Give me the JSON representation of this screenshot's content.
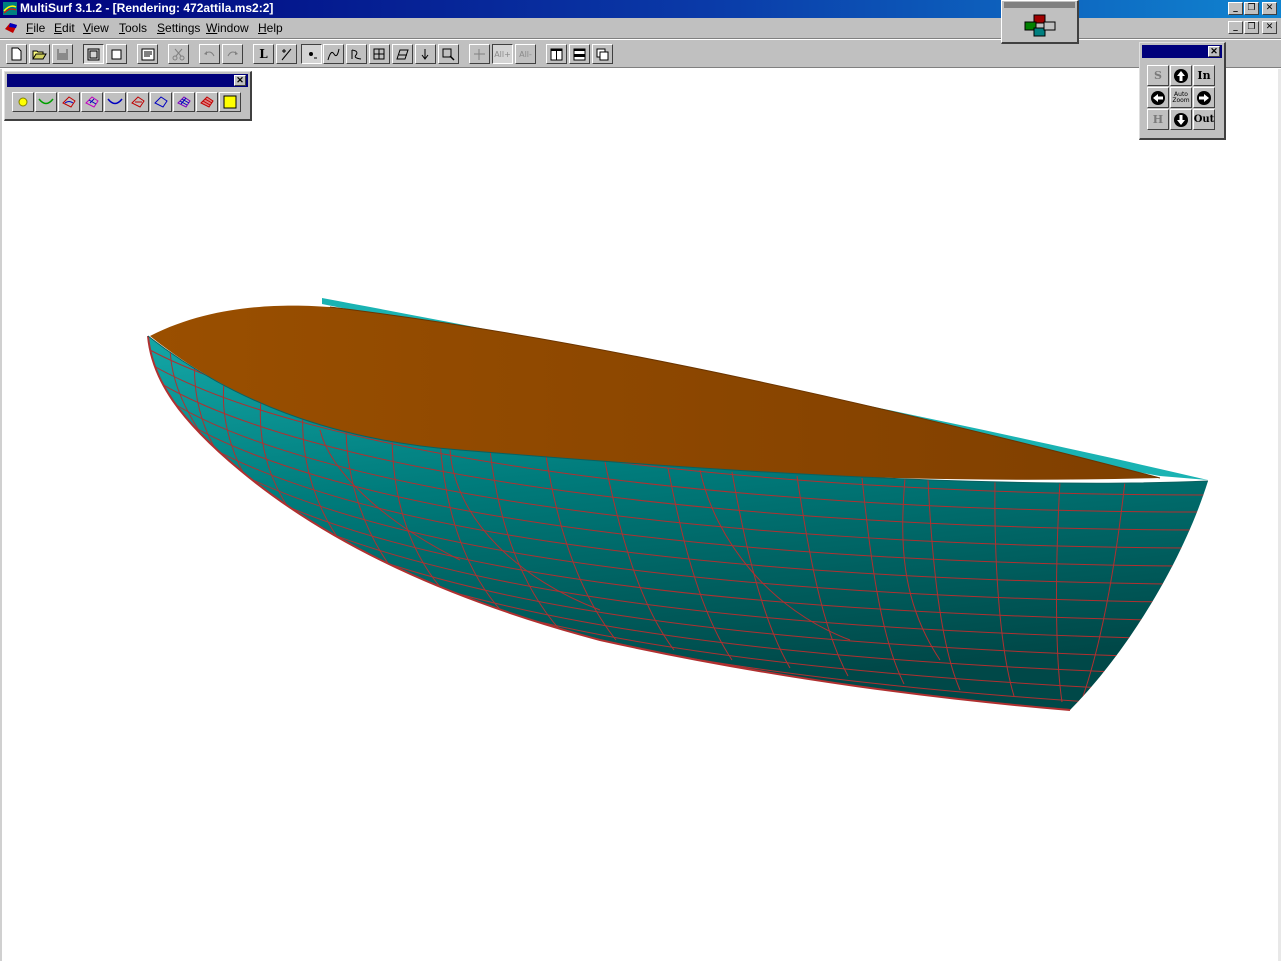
{
  "window": {
    "title": "MultiSurf 3.1.2 - [Rendering: 472attila.ms2:2]",
    "minimize": "_",
    "restore": "❐",
    "close": "✕"
  },
  "menu": {
    "items": [
      "File",
      "Edit",
      "View",
      "Tools",
      "Settings",
      "Window",
      "Help"
    ]
  },
  "toolbar": {
    "buttons": [
      {
        "name": "new-icon"
      },
      {
        "name": "open-icon"
      },
      {
        "name": "save-icon"
      },
      {
        "name": "frame-icon"
      },
      {
        "name": "box-icon"
      },
      {
        "name": "properties-icon"
      },
      {
        "name": "cut-icon"
      },
      {
        "name": "undo-icon"
      },
      {
        "name": "redo-icon"
      },
      {
        "name": "line-tool-icon",
        "label": "L"
      },
      {
        "name": "scale-icon"
      },
      {
        "name": "point-tool-icon"
      },
      {
        "name": "curve-tool-icon"
      },
      {
        "name": "snake-tool-icon"
      },
      {
        "name": "grid-tool-icon"
      },
      {
        "name": "surface-tool-icon"
      },
      {
        "name": "vertex-tool-icon"
      },
      {
        "name": "zoom-box-icon"
      },
      {
        "name": "axis-icon"
      },
      {
        "name": "all-plus-icon",
        "label": "All+"
      },
      {
        "name": "all-minus-icon",
        "label": "All-"
      },
      {
        "name": "tile-vertical-icon"
      },
      {
        "name": "tile-horizontal-icon"
      },
      {
        "name": "cascade-icon"
      }
    ]
  },
  "entity_palette": {
    "buttons": [
      {
        "name": "point-entity-icon",
        "color": "#ffff00"
      },
      {
        "name": "curve-entity-icon",
        "color": "#00a000"
      },
      {
        "name": "snake-entity-icon",
        "color": "#c00000"
      },
      {
        "name": "ruled-surface-icon",
        "color": "#c000c0"
      },
      {
        "name": "blue-curve-icon",
        "color": "#0000c0"
      },
      {
        "name": "red-surface-icon",
        "color": "#c00000"
      },
      {
        "name": "blue-surface-icon",
        "color": "#0000c0"
      },
      {
        "name": "mesh-surface-icon",
        "color": "#8000c0"
      },
      {
        "name": "shaded-surface-icon",
        "color": "#c00000"
      },
      {
        "name": "yellow-square-icon",
        "color": "#ffff00"
      }
    ]
  },
  "nav_palette": {
    "buttons": [
      {
        "name": "snap-button",
        "label": "S"
      },
      {
        "name": "rotate-up-button",
        "label": ""
      },
      {
        "name": "zoom-in-button",
        "label": "In"
      },
      {
        "name": "rotate-left-button",
        "label": ""
      },
      {
        "name": "auto-zoom-button",
        "label": "Auto Zoom"
      },
      {
        "name": "rotate-right-button",
        "label": ""
      },
      {
        "name": "home-button",
        "label": "H"
      },
      {
        "name": "rotate-down-button",
        "label": ""
      },
      {
        "name": "zoom-out-button",
        "label": "Out"
      }
    ]
  },
  "colors": {
    "hull": "#008b8b",
    "hull_dark": "#005a5a",
    "hull_light": "#17b3b3",
    "deck": "#8b4500",
    "grid": "#b03030",
    "titlebar": "#00007b"
  }
}
